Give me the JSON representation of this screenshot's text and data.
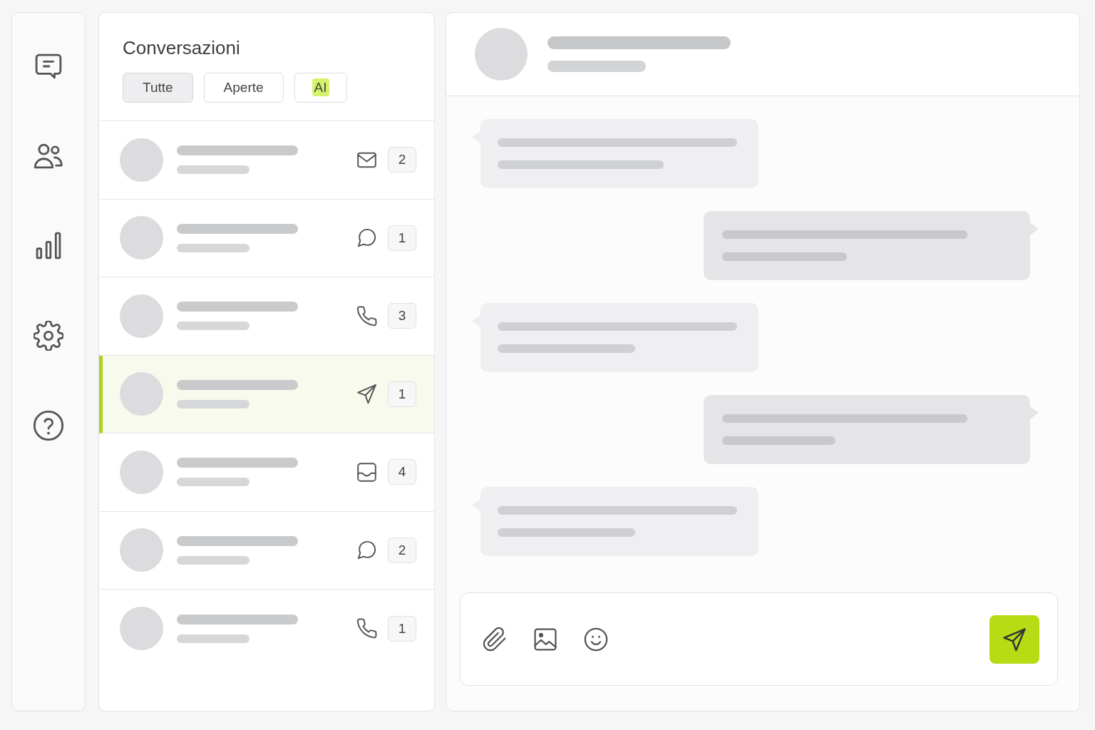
{
  "conversations_panel": {
    "title": "Conversazioni",
    "filters": [
      {
        "label": "Tutte",
        "selected": true,
        "highlighted": false
      },
      {
        "label": "Aperte",
        "selected": false,
        "highlighted": false
      },
      {
        "label": "AI",
        "selected": false,
        "highlighted": true
      }
    ],
    "rows": [
      {
        "kind": "email",
        "count": "2",
        "selected": false
      },
      {
        "kind": "chat",
        "count": "1",
        "selected": false
      },
      {
        "kind": "phone",
        "count": "3",
        "selected": false
      },
      {
        "kind": "sent",
        "count": "1",
        "selected": true
      },
      {
        "kind": "inbox",
        "count": "4",
        "selected": false
      },
      {
        "kind": "chat",
        "count": "2",
        "selected": false
      },
      {
        "kind": "phone",
        "count": "1",
        "selected": false
      }
    ]
  },
  "chat": {
    "messages": [
      {
        "kind": "incoming"
      },
      {
        "kind": "outgoing"
      },
      {
        "kind": "incoming"
      },
      {
        "kind": "outgoing"
      },
      {
        "kind": "incoming"
      }
    ]
  }
}
